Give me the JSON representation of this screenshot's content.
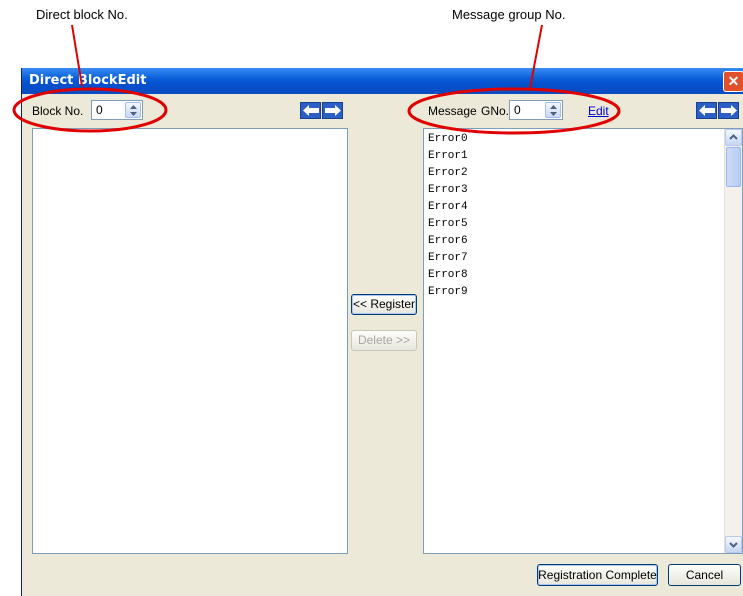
{
  "callouts": {
    "block_label": "Direct block No.",
    "group_label": "Message group No."
  },
  "window": {
    "title": "Direct BlockEdit",
    "close_glyph": "✕"
  },
  "left_panel": {
    "block_label": "Block No.",
    "block_value": "0"
  },
  "right_panel": {
    "message_label": "Message",
    "gno_label": "GNo.",
    "gno_value": "0",
    "edit_link": "Edit",
    "messages": [
      "Error0",
      "Error1",
      "Error2",
      "Error3",
      "Error4",
      "Error5",
      "Error6",
      "Error7",
      "Error8",
      "Error9"
    ]
  },
  "middle": {
    "register_button": "<< Register",
    "delete_button": "Delete >>"
  },
  "footer": {
    "complete_button": "Registration Complete",
    "cancel_button": "Cancel"
  },
  "colors": {
    "highlight_ellipse": "#e00000",
    "title_bar": "#0a5fd8",
    "dialog_face": "#ece9d8"
  },
  "icons": {
    "spin_up": "triangle-up-icon",
    "spin_down": "triangle-down-icon",
    "nav_left": "arrow-left-icon",
    "nav_right": "arrow-right-icon"
  }
}
